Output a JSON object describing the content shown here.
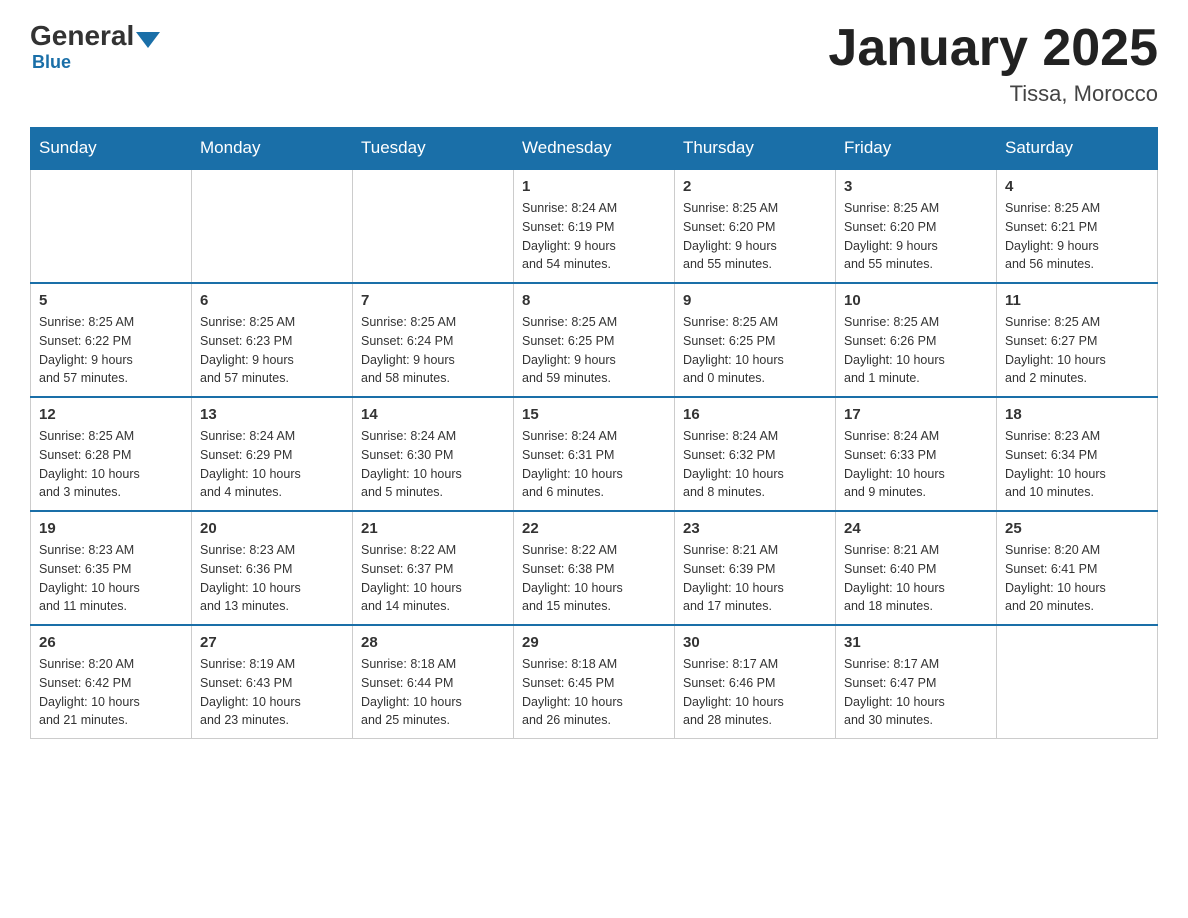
{
  "header": {
    "logo_general": "General",
    "logo_blue": "Blue",
    "title": "January 2025",
    "location": "Tissa, Morocco"
  },
  "weekdays": [
    "Sunday",
    "Monday",
    "Tuesday",
    "Wednesday",
    "Thursday",
    "Friday",
    "Saturday"
  ],
  "weeks": [
    [
      {
        "day": "",
        "info": ""
      },
      {
        "day": "",
        "info": ""
      },
      {
        "day": "",
        "info": ""
      },
      {
        "day": "1",
        "info": "Sunrise: 8:24 AM\nSunset: 6:19 PM\nDaylight: 9 hours\nand 54 minutes."
      },
      {
        "day": "2",
        "info": "Sunrise: 8:25 AM\nSunset: 6:20 PM\nDaylight: 9 hours\nand 55 minutes."
      },
      {
        "day": "3",
        "info": "Sunrise: 8:25 AM\nSunset: 6:20 PM\nDaylight: 9 hours\nand 55 minutes."
      },
      {
        "day": "4",
        "info": "Sunrise: 8:25 AM\nSunset: 6:21 PM\nDaylight: 9 hours\nand 56 minutes."
      }
    ],
    [
      {
        "day": "5",
        "info": "Sunrise: 8:25 AM\nSunset: 6:22 PM\nDaylight: 9 hours\nand 57 minutes."
      },
      {
        "day": "6",
        "info": "Sunrise: 8:25 AM\nSunset: 6:23 PM\nDaylight: 9 hours\nand 57 minutes."
      },
      {
        "day": "7",
        "info": "Sunrise: 8:25 AM\nSunset: 6:24 PM\nDaylight: 9 hours\nand 58 minutes."
      },
      {
        "day": "8",
        "info": "Sunrise: 8:25 AM\nSunset: 6:25 PM\nDaylight: 9 hours\nand 59 minutes."
      },
      {
        "day": "9",
        "info": "Sunrise: 8:25 AM\nSunset: 6:25 PM\nDaylight: 10 hours\nand 0 minutes."
      },
      {
        "day": "10",
        "info": "Sunrise: 8:25 AM\nSunset: 6:26 PM\nDaylight: 10 hours\nand 1 minute."
      },
      {
        "day": "11",
        "info": "Sunrise: 8:25 AM\nSunset: 6:27 PM\nDaylight: 10 hours\nand 2 minutes."
      }
    ],
    [
      {
        "day": "12",
        "info": "Sunrise: 8:25 AM\nSunset: 6:28 PM\nDaylight: 10 hours\nand 3 minutes."
      },
      {
        "day": "13",
        "info": "Sunrise: 8:24 AM\nSunset: 6:29 PM\nDaylight: 10 hours\nand 4 minutes."
      },
      {
        "day": "14",
        "info": "Sunrise: 8:24 AM\nSunset: 6:30 PM\nDaylight: 10 hours\nand 5 minutes."
      },
      {
        "day": "15",
        "info": "Sunrise: 8:24 AM\nSunset: 6:31 PM\nDaylight: 10 hours\nand 6 minutes."
      },
      {
        "day": "16",
        "info": "Sunrise: 8:24 AM\nSunset: 6:32 PM\nDaylight: 10 hours\nand 8 minutes."
      },
      {
        "day": "17",
        "info": "Sunrise: 8:24 AM\nSunset: 6:33 PM\nDaylight: 10 hours\nand 9 minutes."
      },
      {
        "day": "18",
        "info": "Sunrise: 8:23 AM\nSunset: 6:34 PM\nDaylight: 10 hours\nand 10 minutes."
      }
    ],
    [
      {
        "day": "19",
        "info": "Sunrise: 8:23 AM\nSunset: 6:35 PM\nDaylight: 10 hours\nand 11 minutes."
      },
      {
        "day": "20",
        "info": "Sunrise: 8:23 AM\nSunset: 6:36 PM\nDaylight: 10 hours\nand 13 minutes."
      },
      {
        "day": "21",
        "info": "Sunrise: 8:22 AM\nSunset: 6:37 PM\nDaylight: 10 hours\nand 14 minutes."
      },
      {
        "day": "22",
        "info": "Sunrise: 8:22 AM\nSunset: 6:38 PM\nDaylight: 10 hours\nand 15 minutes."
      },
      {
        "day": "23",
        "info": "Sunrise: 8:21 AM\nSunset: 6:39 PM\nDaylight: 10 hours\nand 17 minutes."
      },
      {
        "day": "24",
        "info": "Sunrise: 8:21 AM\nSunset: 6:40 PM\nDaylight: 10 hours\nand 18 minutes."
      },
      {
        "day": "25",
        "info": "Sunrise: 8:20 AM\nSunset: 6:41 PM\nDaylight: 10 hours\nand 20 minutes."
      }
    ],
    [
      {
        "day": "26",
        "info": "Sunrise: 8:20 AM\nSunset: 6:42 PM\nDaylight: 10 hours\nand 21 minutes."
      },
      {
        "day": "27",
        "info": "Sunrise: 8:19 AM\nSunset: 6:43 PM\nDaylight: 10 hours\nand 23 minutes."
      },
      {
        "day": "28",
        "info": "Sunrise: 8:18 AM\nSunset: 6:44 PM\nDaylight: 10 hours\nand 25 minutes."
      },
      {
        "day": "29",
        "info": "Sunrise: 8:18 AM\nSunset: 6:45 PM\nDaylight: 10 hours\nand 26 minutes."
      },
      {
        "day": "30",
        "info": "Sunrise: 8:17 AM\nSunset: 6:46 PM\nDaylight: 10 hours\nand 28 minutes."
      },
      {
        "day": "31",
        "info": "Sunrise: 8:17 AM\nSunset: 6:47 PM\nDaylight: 10 hours\nand 30 minutes."
      },
      {
        "day": "",
        "info": ""
      }
    ]
  ]
}
